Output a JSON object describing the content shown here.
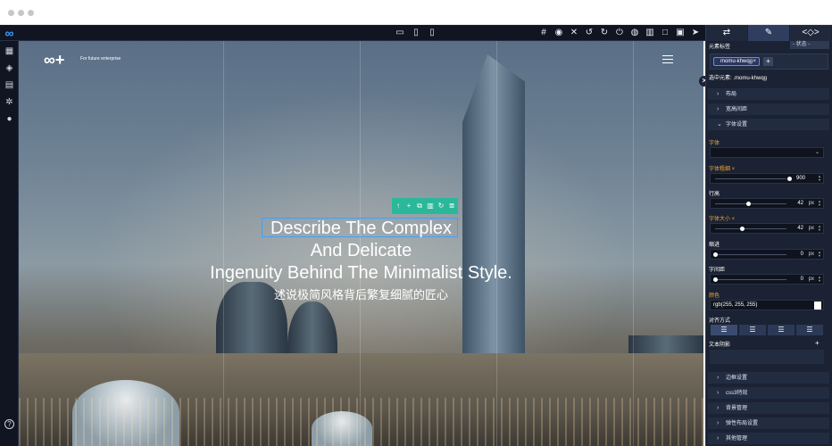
{
  "topbar": {
    "device_icons": [
      "desktop-icon",
      "tablet-icon",
      "mobile-icon"
    ],
    "tool_icons": [
      "hash-icon",
      "eye-icon",
      "expand-icon",
      "undo-icon",
      "redo-icon",
      "power-icon",
      "bulb-icon",
      "trash-icon",
      "square-icon",
      "code-icon",
      "send-icon"
    ]
  },
  "left_rail": [
    "grid-icon",
    "layers-icon",
    "page-icon",
    "gear-icon",
    "drop-icon"
  ],
  "canvas": {
    "site_tagline": "For future enterprise",
    "headline": [
      "Describe The Complex",
      "And Delicate",
      "Ingenuity Behind The Minimalist Style."
    ],
    "subline": "述说极简风格背后繁复细腻的匠心"
  },
  "panel": {
    "element_tag_label": "元素标签",
    "state_select": "- 状态 -",
    "class_chip": "momu-khwqg",
    "chip_remove": "×",
    "add_class": "+",
    "selected_prefix": "选中元素:",
    "selected_value": ".momu-khwqg",
    "sections_top": [
      {
        "label": "布局",
        "chev": "›"
      },
      {
        "label": "宽高间距",
        "chev": "›"
      },
      {
        "label": "字体设置",
        "chev": "⌄"
      }
    ],
    "font_label": "字体",
    "font_value": "",
    "weight_label": "字体粗细 ×",
    "weight_value": "900",
    "line_height_label": "行高",
    "line_height_value": "42",
    "size_label": "字体大小 ×",
    "size_value": "42",
    "indent_label": "缩进",
    "indent_value": "0",
    "spacing_label": "字间距",
    "spacing_value": "0",
    "unit": "px",
    "color_label": "颜色",
    "color_value": "rgb(255, 255, 255)",
    "align_label": "对齐方式",
    "text_shadow_label": "文本阴影",
    "text_shadow_add": "+",
    "sections_bottom": [
      {
        "label": "边框设置",
        "chev": "›"
      },
      {
        "label": "css3特效",
        "chev": "›"
      },
      {
        "label": "背景管理",
        "chev": "›"
      },
      {
        "label": "弹性布局设置",
        "chev": "›"
      },
      {
        "label": "其他管理",
        "chev": "›"
      }
    ]
  },
  "colors": {
    "accent": "#3ea0ff",
    "toolbar_green": "#2bb89a",
    "label_orange": "#f0a531",
    "panel_bg": "#1a2233"
  }
}
